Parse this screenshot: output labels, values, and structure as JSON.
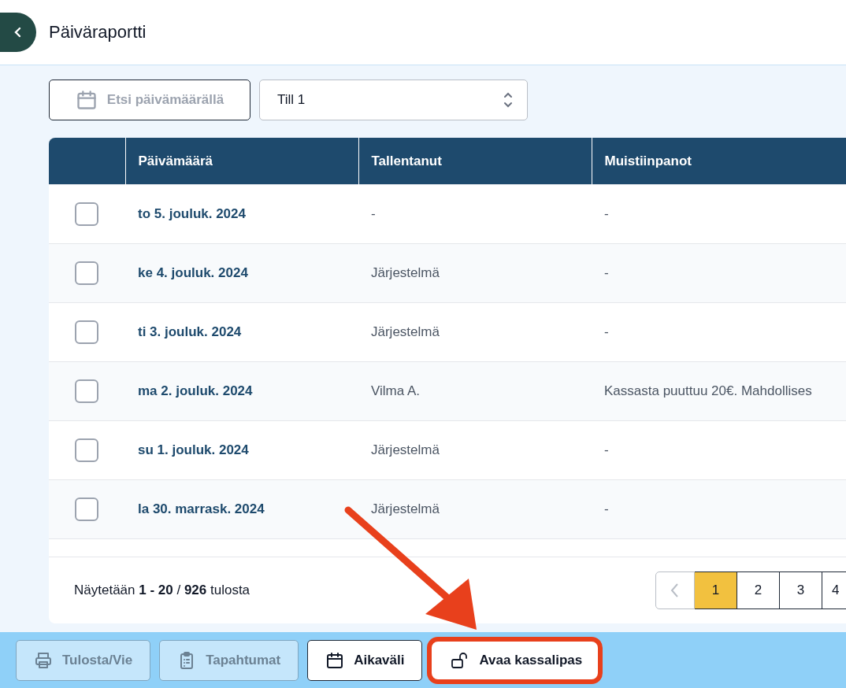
{
  "header": {
    "title": "Päiväraportti"
  },
  "filters": {
    "date_search": {
      "label": "Etsi päivämäärällä"
    },
    "register_select": {
      "value": "Till 1"
    }
  },
  "table": {
    "columns": [
      "Päivämäärä",
      "Tallentanut",
      "Muistiinpanot"
    ],
    "rows": [
      {
        "checked": false,
        "date": "to 5. jouluk. 2024",
        "saved_by": "-",
        "notes": "-"
      },
      {
        "checked": false,
        "date": "ke 4. jouluk. 2024",
        "saved_by": "Järjestelmä",
        "notes": "-"
      },
      {
        "checked": false,
        "date": "ti 3. jouluk. 2024",
        "saved_by": "Järjestelmä",
        "notes": "-"
      },
      {
        "checked": false,
        "date": "ma 2. jouluk. 2024",
        "saved_by": "Vilma A.",
        "notes": "Kassasta puuttuu 20€. Mahdollises"
      },
      {
        "checked": false,
        "date": "su 1. jouluk. 2024",
        "saved_by": "Järjestelmä",
        "notes": "-"
      },
      {
        "checked": false,
        "date": "la 30. marrask. 2024",
        "saved_by": "Järjestelmä",
        "notes": "-"
      }
    ]
  },
  "footer": {
    "summary": "Näytetään **1 - 20** / **926** tulosta",
    "pages": [
      {
        "label": "1",
        "selected": true
      },
      {
        "label": "2",
        "selected": false
      },
      {
        "label": "3",
        "selected": false
      },
      {
        "label": "4",
        "selected": false
      }
    ]
  },
  "toolbar": [
    {
      "label": "Tulosta/Vie",
      "kind": "printer",
      "disabled": true,
      "highlighted": false
    },
    {
      "label": "Tapahtumat",
      "kind": "clipboard",
      "disabled": true,
      "highlighted": false
    },
    {
      "label": "Aikaväli",
      "kind": "calendar",
      "disabled": false,
      "highlighted": false
    },
    {
      "label": "Avaa kassalipas",
      "kind": "lock",
      "disabled": false,
      "highlighted": true
    }
  ]
}
